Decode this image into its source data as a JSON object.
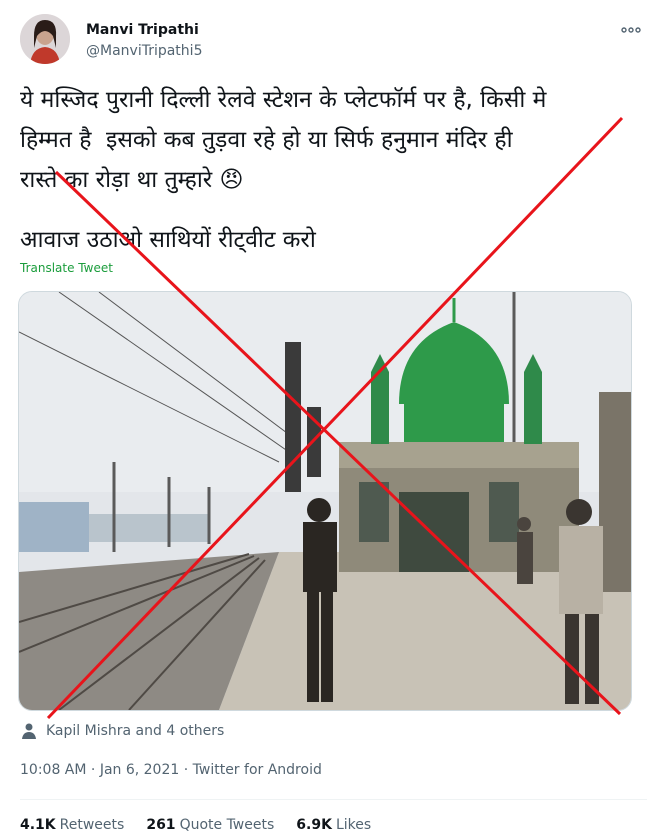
{
  "user": {
    "display_name": "Manvi Tripathi",
    "handle": "@ManviTripathi5",
    "avatar": "profile-photo"
  },
  "tweet": {
    "lines": [
      "ये मस्जिद पुरानी दिल्ली रेलवे स्टेशन के प्लेटफॉर्म पर है, किसी मे",
      "हिम्मत है  इसको कब तुड़वा रहे हो या सिर्फ हनुमान मंदिर ही",
      "रास्ते का रोड़ा था तुम्हारे 😠",
      "",
      "आवाज उठाओ साथियों रीट्वीट करो"
    ],
    "translate_label": "Translate Tweet"
  },
  "media": {
    "description_icon": "photo-mosque-railway-platform",
    "overlay": "red-cross"
  },
  "tagged": {
    "icon": "person-icon",
    "label": "Kapil Mishra and 4 others"
  },
  "meta": {
    "time": "10:08 AM",
    "date": "Jan 6, 2021",
    "source": "Twitter for Android"
  },
  "stats": {
    "retweets_value": "4.1K",
    "retweets_label": "Retweets",
    "quotes_value": "261",
    "quotes_label": "Quote Tweets",
    "likes_value": "6.9K",
    "likes_label": "Likes"
  },
  "colors": {
    "text": "#0f1419",
    "secondary": "#536471",
    "translate": "#1b9d3c",
    "cross": "#e8141b",
    "dome": "#2e9a4a"
  }
}
